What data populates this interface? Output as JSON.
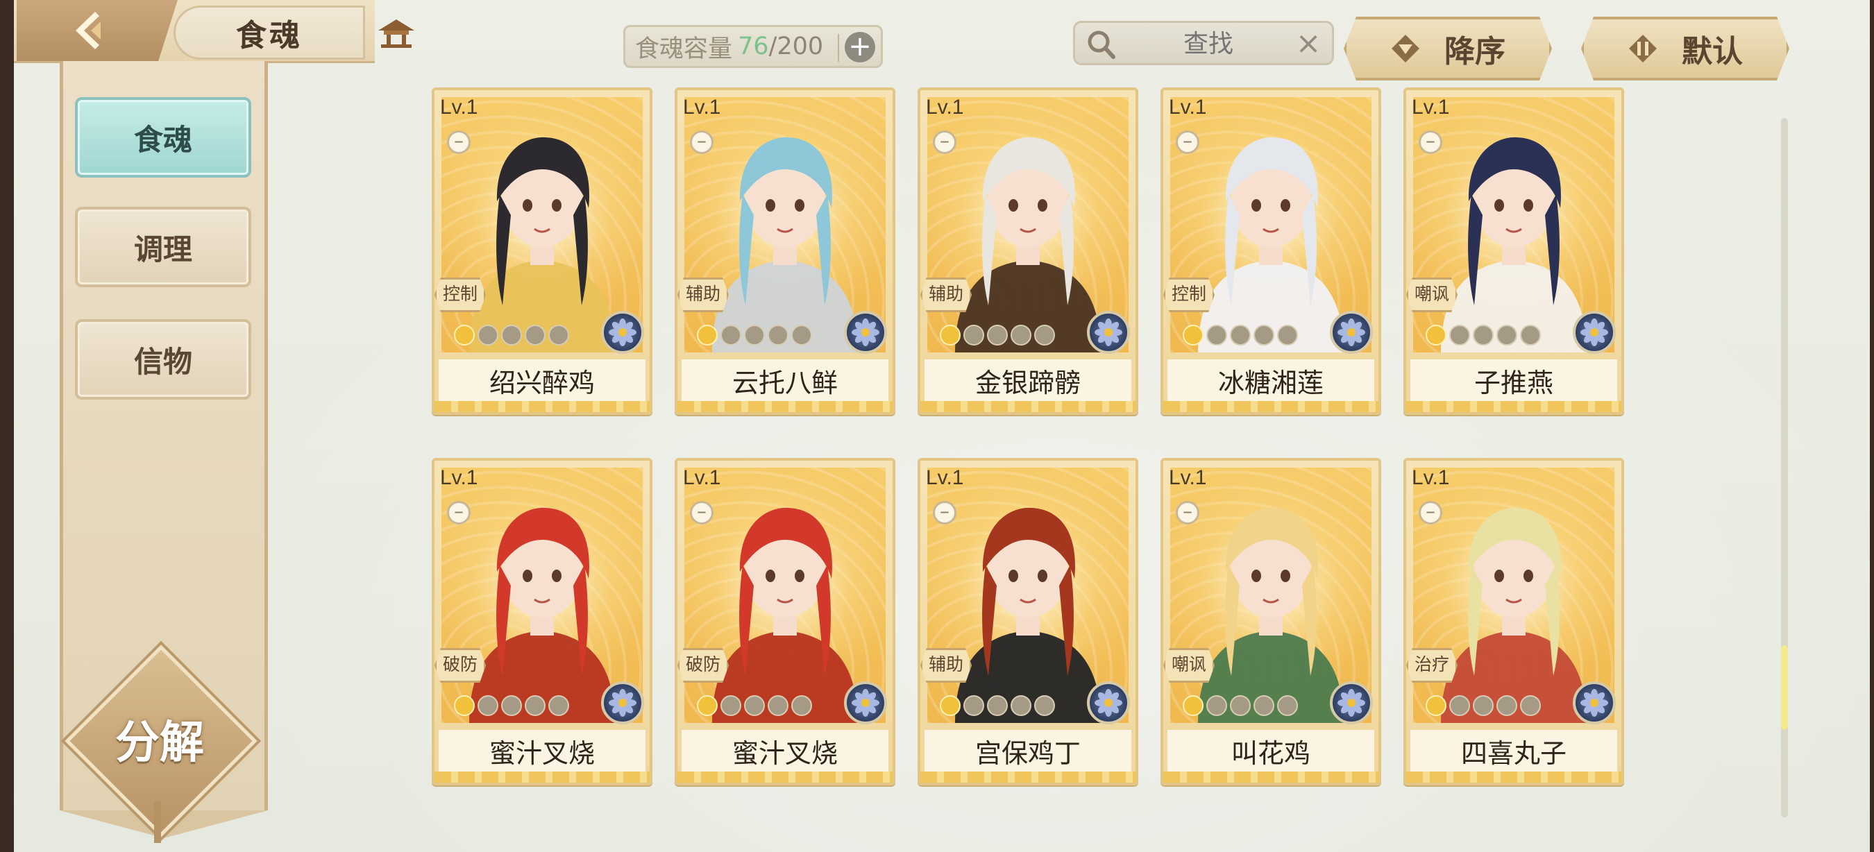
{
  "header": {
    "title": "食魂"
  },
  "sidebar": {
    "items": [
      {
        "label": "食魂",
        "active": true
      },
      {
        "label": "调理",
        "active": false
      },
      {
        "label": "信物",
        "active": false
      }
    ],
    "decompose_label": "分解"
  },
  "capacity": {
    "label": "食魂容量",
    "current": "76",
    "max": "/200",
    "add_icon": "plus-icon"
  },
  "search": {
    "placeholder": "查找",
    "value": ""
  },
  "sort": {
    "order_label": "降序",
    "mode_label": "默认"
  },
  "colors": {
    "active_tab": "#a8dcd6",
    "card_gold": "#f0b84e",
    "capacity_current": "#7cc28b"
  },
  "cards": [
    {
      "level": "Lv.1",
      "role": "控制",
      "name": "绍兴醉鸡",
      "stars": 1,
      "hair": "#2c2a2e",
      "outfit": "#e8c25a"
    },
    {
      "level": "Lv.1",
      "role": "辅助",
      "name": "云托八鲜",
      "stars": 1,
      "hair": "#8ec8d8",
      "outfit": "#cfd4d8"
    },
    {
      "level": "Lv.1",
      "role": "辅助",
      "name": "金银蹄髈",
      "stars": 1,
      "hair": "#e9e6df",
      "outfit": "#4a3322"
    },
    {
      "level": "Lv.1",
      "role": "控制",
      "name": "冰糖湘莲",
      "stars": 1,
      "hair": "#e4e7ec",
      "outfit": "#f1f1f4"
    },
    {
      "level": "Lv.1",
      "role": "嘲讽",
      "name": "子推燕",
      "stars": 1,
      "hair": "#2a3154",
      "outfit": "#f3f0ea"
    },
    {
      "level": "Lv.1",
      "role": "破防",
      "name": "蜜汁叉烧",
      "stars": 1,
      "hair": "#d2392a",
      "outfit": "#b6341f"
    },
    {
      "level": "Lv.1",
      "role": "破防",
      "name": "蜜汁叉烧",
      "stars": 1,
      "hair": "#d2392a",
      "outfit": "#b6341f"
    },
    {
      "level": "Lv.1",
      "role": "辅助",
      "name": "宫保鸡丁",
      "stars": 1,
      "hair": "#a4371d",
      "outfit": "#232426"
    },
    {
      "level": "Lv.1",
      "role": "嘲讽",
      "name": "叫花鸡",
      "stars": 1,
      "hair": "#f1d48a",
      "outfit": "#4d7b4e"
    },
    {
      "level": "Lv.1",
      "role": "治疗",
      "name": "四喜丸子",
      "stars": 1,
      "hair": "#e9e1a1",
      "outfit": "#c44a37"
    }
  ]
}
